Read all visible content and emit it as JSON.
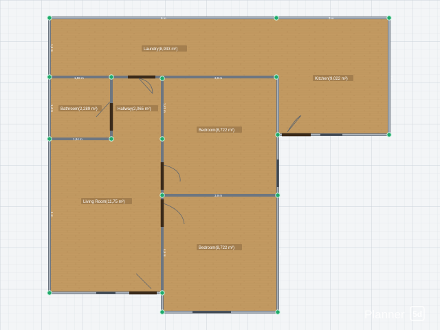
{
  "app": {
    "brand_name": "Planner",
    "brand_badge": "5d"
  },
  "colors": {
    "floor": "#c39a62",
    "grid_bg": "#f3f5f7",
    "wall": "#6d7681",
    "node": "#1faa6b"
  },
  "rooms": {
    "laundry": "Laundry(8,933 m²)",
    "kitchen": "Kitchen(9,022 m²)",
    "bathroom": "Bathroom(2,289 m²)",
    "hallway": "Hallway(2,065 m²)",
    "bedroom_top": "Bedroom(8,722 m²)",
    "bedroom_bottom": "Bedroom(8,722 m²)",
    "living_room": "Living Room(11,75 m²)"
  },
  "dimensions": {
    "top_left": "6 m",
    "top_right": "3 m",
    "left_top": "1,6 m",
    "right_top": "3 m",
    "bath_width": "1,59 m",
    "bedroom_top_width": "3,9 m",
    "bath_height": "1,4 m",
    "hall_height": "1,41 m",
    "bath_bottom_width": "1,84 m",
    "bedroom_bottom_width": "3,9 m",
    "living_left": "4 m",
    "bedroom_right": "3 m",
    "living_right": "4,5 m"
  }
}
